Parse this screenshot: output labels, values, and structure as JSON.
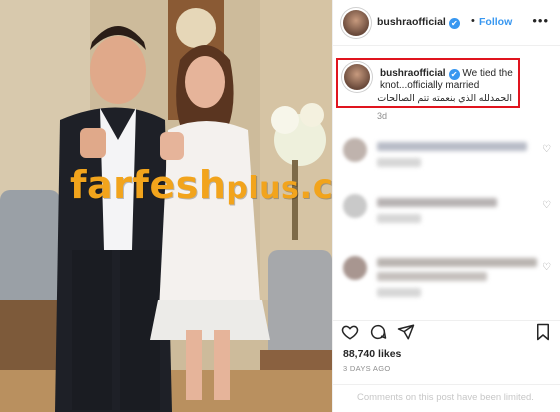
{
  "post": {
    "username": "bushraofficial",
    "follow_label": "Follow",
    "dot": "•",
    "more_label": "•••",
    "caption_text": "We tied the knot...officially married",
    "caption_arabic": "الحمدلله الذي بنعمته تتم الصالحات",
    "time_short": "3d",
    "likes": "88,740 likes",
    "time_ago": "3 DAYS AGO",
    "comments_disabled": "Comments on this post have been limited."
  },
  "watermark": {
    "part1": "farfesh",
    "part2": "plus",
    "part3": ".com"
  },
  "icons": {
    "verified": "✔"
  },
  "colors": {
    "accent": "#3897f0",
    "highlight_border": "#e0141e",
    "watermark": "#f2a41c"
  }
}
